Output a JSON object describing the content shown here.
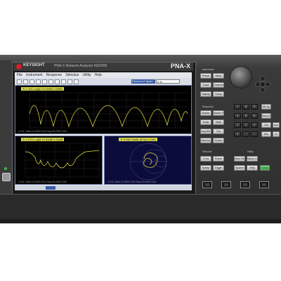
{
  "device": {
    "brand": "KEYSIGHT",
    "subtitle": "PNA-X Network Analyzer  N5245B",
    "model": "PNA-X"
  },
  "menu": [
    "File",
    "Instrument",
    "Response",
    "Stimulus",
    "Utility",
    "Help"
  ],
  "toolbar": {
    "buttons": [
      "open-icon",
      "save-icon",
      "print-icon",
      "undo-icon",
      "marker-icon",
      "zoom-icon",
      "autoscale-icon",
      "measure-icon",
      "cal-icon",
      "window-icon"
    ],
    "search_label": "Percent of Span:",
    "search_value": "0 %"
  },
  "traces": {
    "t1_label": "Tr 1  S11 LogM 10.00dB/ 0.00dB",
    "t1_foot": ">Ch1: Start 10.0000 GHz                    Stop 50.0000 GHz",
    "t2_label": "Tr 2  S21 LogM 10.00dB/ 0.00dB",
    "t2_foot": ">Ch2: Start 10.0000 GHz        Stop 50.0000 GHz",
    "t3_label": "Tr 3  S22 Smith (R+jX) 1.00U",
    "t3_foot": ">Ch3: Start 10.0000 GHz        Stop 50.0000 GHz"
  },
  "hardkeys": {
    "instrument_label": "Instrument",
    "response_label": "Response",
    "stimulus_label": "Stimulus",
    "utility_label": "Utility",
    "instrument": [
      "Preset",
      "Meas",
      "Trace",
      "Channel",
      "Display",
      "Setup"
    ],
    "response": [
      "Marker",
      "Marker Fctn",
      "Scale",
      "Math",
      "Avg BW",
      "Cal",
      "Memory",
      "Search"
    ],
    "stimulus": [
      "Freq",
      "Power",
      "Sweep",
      "Trigger"
    ],
    "utility": [
      "Save Recall",
      "Macro Local",
      "System",
      "Help",
      "Preset"
    ],
    "numpad": [
      "7",
      "8",
      "9",
      "4",
      "5",
      "6",
      "1",
      "2",
      "3",
      "0",
      ".",
      "-"
    ],
    "numpad_side": [
      "Bk Sp",
      "Entry Off",
      "G/n",
      "M/u",
      "k/m",
      "x1"
    ]
  },
  "colors": {
    "trace": "#d7d341",
    "screen_bg": "#000000",
    "smith_bg": "#0c0c3c",
    "accent": "#3c5ea8",
    "power_led": "#3cbf3c",
    "logo": "#d0202a"
  }
}
